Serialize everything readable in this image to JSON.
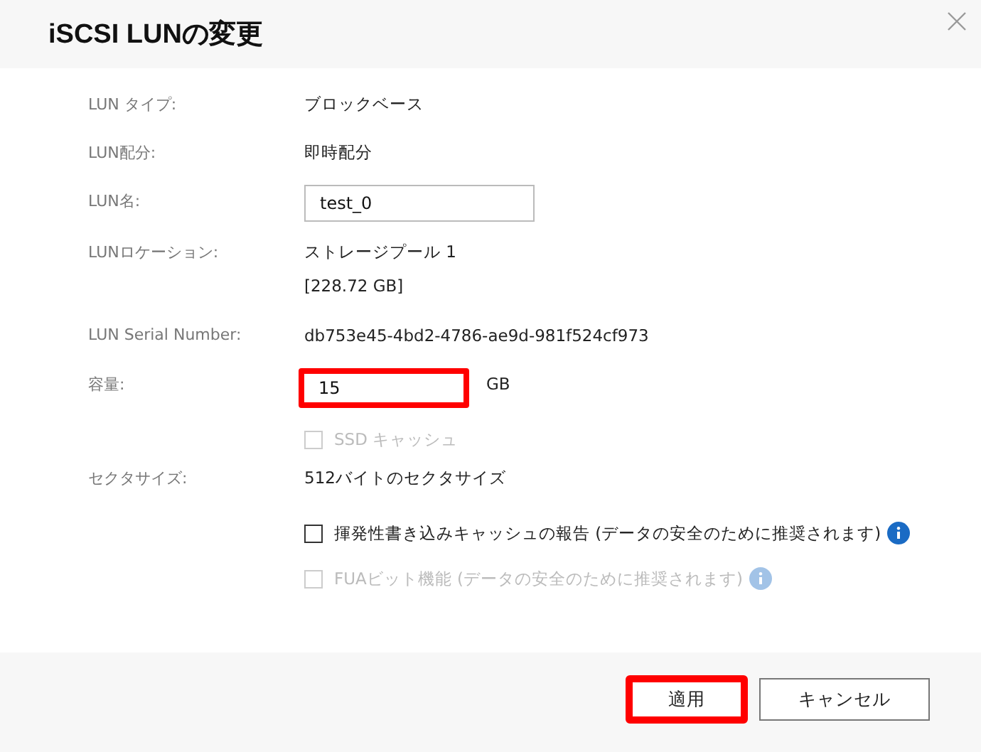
{
  "dialog": {
    "title": "iSCSI LUNの変更"
  },
  "rows": [
    {
      "kind": "text",
      "label": "LUN タイプ:",
      "values": [
        "ブロックベース"
      ]
    },
    {
      "kind": "text",
      "label": "LUN配分:",
      "values": [
        "即時配分"
      ]
    },
    {
      "kind": "input",
      "label": "LUN名:",
      "value": "test_0",
      "highlighted": false
    },
    {
      "kind": "text",
      "label": "LUNロケーション:",
      "values": [
        "ストレージプール 1",
        "[228.72 GB]"
      ]
    },
    {
      "kind": "text",
      "label": "LUN Serial Number:",
      "values": [
        "db753e45-4bd2-4786-ae9d-981f524cf973"
      ]
    },
    {
      "kind": "input",
      "label": "容量:",
      "value": "15",
      "unit": "GB",
      "highlighted": true
    },
    {
      "kind": "checkbox",
      "text": "SSD キャッシュ",
      "checked": false,
      "disabled": true,
      "info": false
    },
    {
      "kind": "text",
      "label": "セクタサイズ:",
      "values": [
        "512バイトのセクタサイズ"
      ]
    },
    {
      "kind": "checkbox",
      "text": "揮発性書き込みキャッシュの報告 (データの安全のために推奨されます)",
      "checked": false,
      "disabled": false,
      "info": true
    },
    {
      "kind": "checkbox",
      "text": "FUAビット機能 (データの安全のために推奨されます)",
      "checked": false,
      "disabled": true,
      "info": true
    }
  ],
  "buttons": [
    {
      "label": "適用",
      "highlighted": true
    },
    {
      "label": "キャンセル",
      "highlighted": false
    }
  ]
}
